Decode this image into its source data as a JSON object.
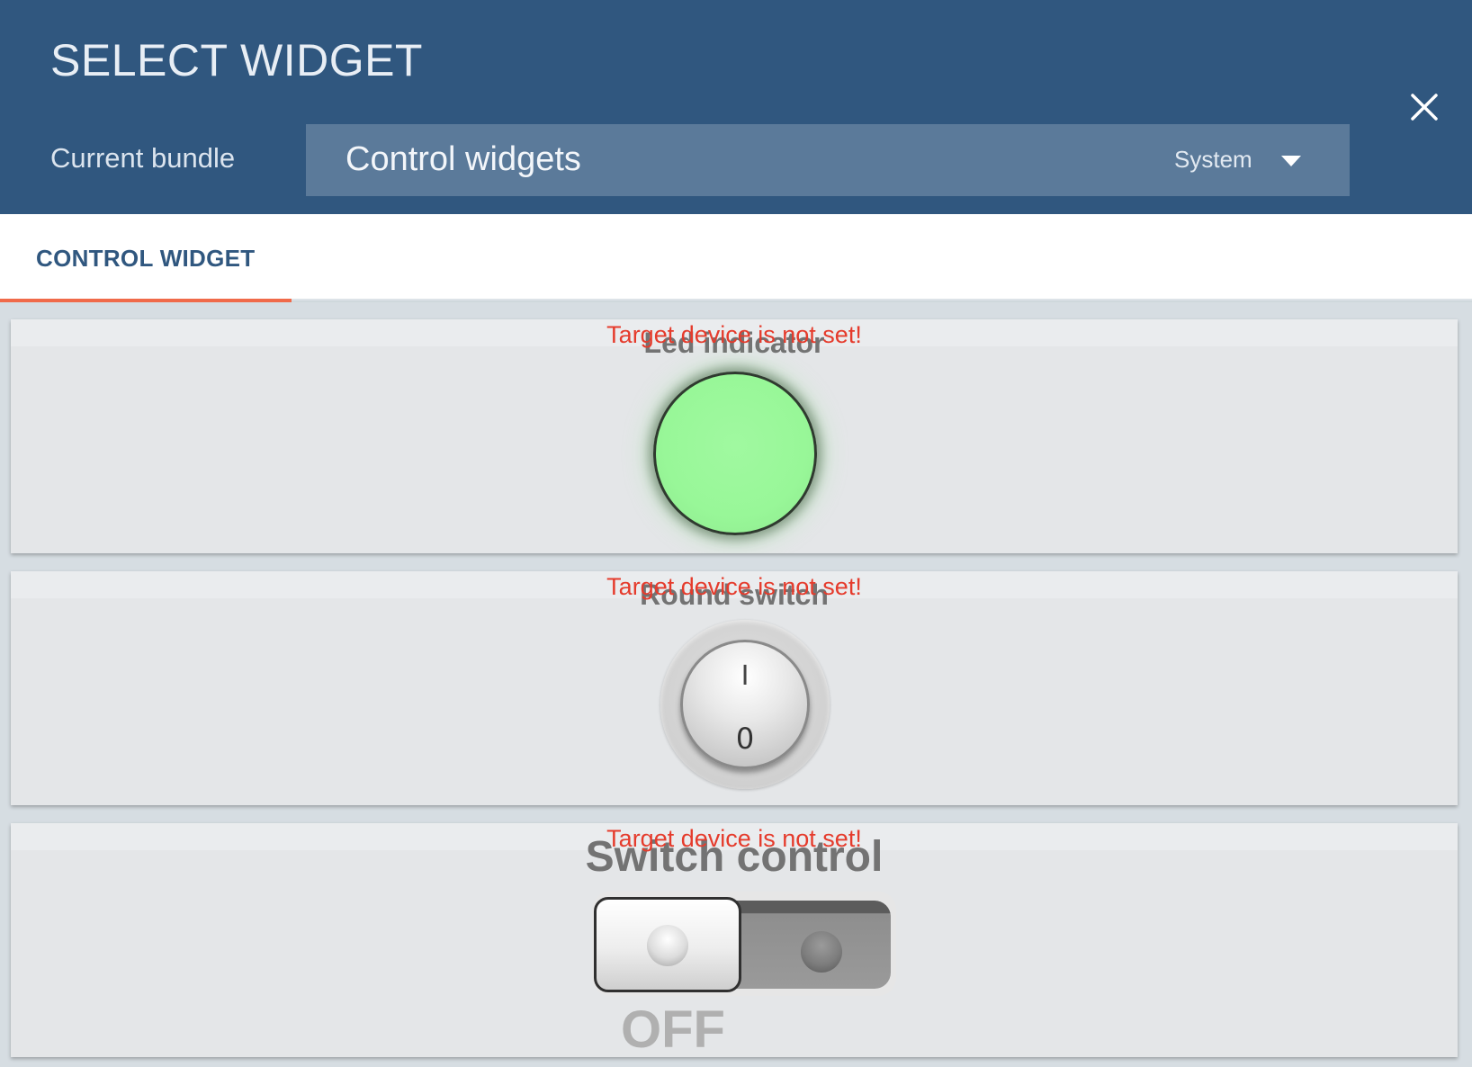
{
  "dialog": {
    "title": "SELECT WIDGET",
    "close_icon": "close-icon"
  },
  "bundle": {
    "label": "Current bundle",
    "selected": "Control widgets",
    "scope": "System",
    "dropdown_icon": "chevron-down-icon"
  },
  "tabs": [
    {
      "label": "CONTROL WIDGET",
      "active": true
    }
  ],
  "widgets": [
    {
      "title": "Led indicator",
      "error": "Target device is not set!",
      "led_color": "#98f798"
    },
    {
      "title": "Round switch",
      "error": "Target device is not set!",
      "on_label": "I",
      "off_label": "0"
    },
    {
      "title": "Switch control",
      "error": "Target device is not set!",
      "state_label": "OFF"
    }
  ],
  "colors": {
    "header_bg": "#30577f",
    "select_bg": "#5b7a9a",
    "tab_accent": "#f06a4a",
    "error_text": "#e53b2c",
    "card_bg": "#e4e6e8"
  }
}
